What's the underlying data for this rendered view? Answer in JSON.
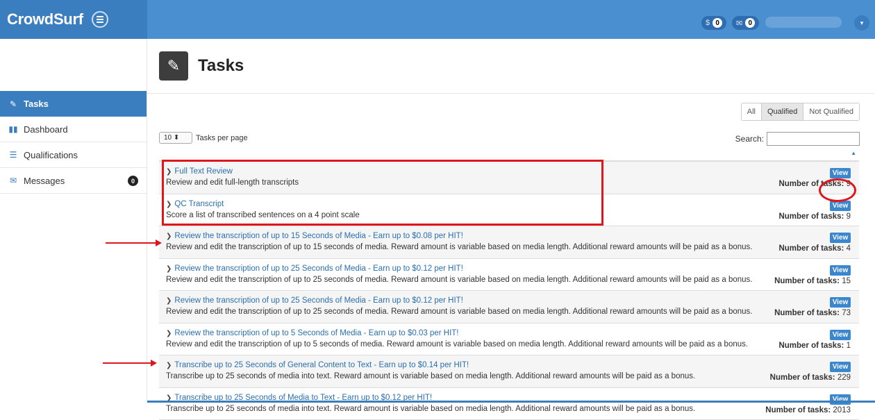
{
  "brand": {
    "name": "CrowdSurf"
  },
  "topnav": {
    "money_symbol": "$",
    "money_count": "0",
    "mail_symbol": "✉",
    "mail_count": "0",
    "user_caret": "▾"
  },
  "sidebar": {
    "items": [
      {
        "label": "Tasks",
        "icon": "edit-icon",
        "active": true
      },
      {
        "label": "Dashboard",
        "icon": "briefcase-icon"
      },
      {
        "label": "Qualifications",
        "icon": "list-icon"
      },
      {
        "label": "Messages",
        "icon": "envelope-icon",
        "badge": "0"
      }
    ]
  },
  "page": {
    "title": "Tasks"
  },
  "filter": {
    "all": "All",
    "qualified": "Qualified",
    "not_qualified": "Not Qualified",
    "selected": "Qualified"
  },
  "table_controls": {
    "per_page_value": "10",
    "per_page_label": "Tasks per page",
    "search_label": "Search:",
    "search_value": ""
  },
  "tasks": [
    {
      "title": "Full Text Review",
      "desc": "Review and edit full-length transcripts",
      "view": "View",
      "count_label": "Number of tasks:",
      "count": "9"
    },
    {
      "title": "QC Transcript",
      "desc": "Score a list of transcribed sentences on a 4 point scale",
      "view": "View",
      "count_label": "Number of tasks:",
      "count": "9"
    },
    {
      "title": "Review the transcription of up to 15 Seconds of Media - Earn up to $0.08 per HIT!",
      "desc": "Review and edit the transcription of up to 15 seconds of media. Reward amount is variable based on media length. Additional reward amounts will be paid as a bonus.",
      "view": "View",
      "count_label": "Number of tasks:",
      "count": "4"
    },
    {
      "title": "Review the transcription of up to 25 Seconds of Media - Earn up to $0.12 per HIT!",
      "desc": "Review and edit the transcription of up to 25 seconds of media. Reward amount is variable based on media length. Additional reward amounts will be paid as a bonus.",
      "view": "View",
      "count_label": "Number of tasks:",
      "count": "15"
    },
    {
      "title": "Review the transcription of up to 25 Seconds of Media - Earn up to $0.12 per HIT!",
      "desc": "Review and edit the transcription of up to 25 seconds of media. Reward amount is variable based on media length. Additional reward amounts will be paid as a bonus.",
      "view": "View",
      "count_label": "Number of tasks:",
      "count": "73"
    },
    {
      "title": "Review the transcription of up to 5 Seconds of Media - Earn up to $0.03 per HIT!",
      "desc": "Review and edit the transcription of up to 5 seconds of media. Reward amount is variable based on media length. Additional reward amounts will be paid as a bonus.",
      "view": "View",
      "count_label": "Number of tasks:",
      "count": "1"
    },
    {
      "title": "Transcribe up to 25 Seconds of General Content to Text - Earn up to $0.14 per HIT!",
      "desc": "Transcribe up to 25 seconds of media into text. Reward amount is variable based on media length. Additional reward amounts will be paid as a bonus.",
      "view": "View",
      "count_label": "Number of tasks:",
      "count": "229"
    },
    {
      "title": "Transcribe up to 25 Seconds of Media to Text - Earn up to $0.12 per HIT!",
      "desc": "Transcribe up to 25 seconds of media into text. Reward amount is variable based on media length. Additional reward amounts will be paid as a bonus.",
      "view": "View",
      "count_label": "Number of tasks:",
      "count": "2013"
    }
  ],
  "colors": {
    "brand": "#3a7ebf",
    "topnav": "#4a8fd0",
    "link": "#2a6fb0",
    "annotation": "#e0161c"
  }
}
